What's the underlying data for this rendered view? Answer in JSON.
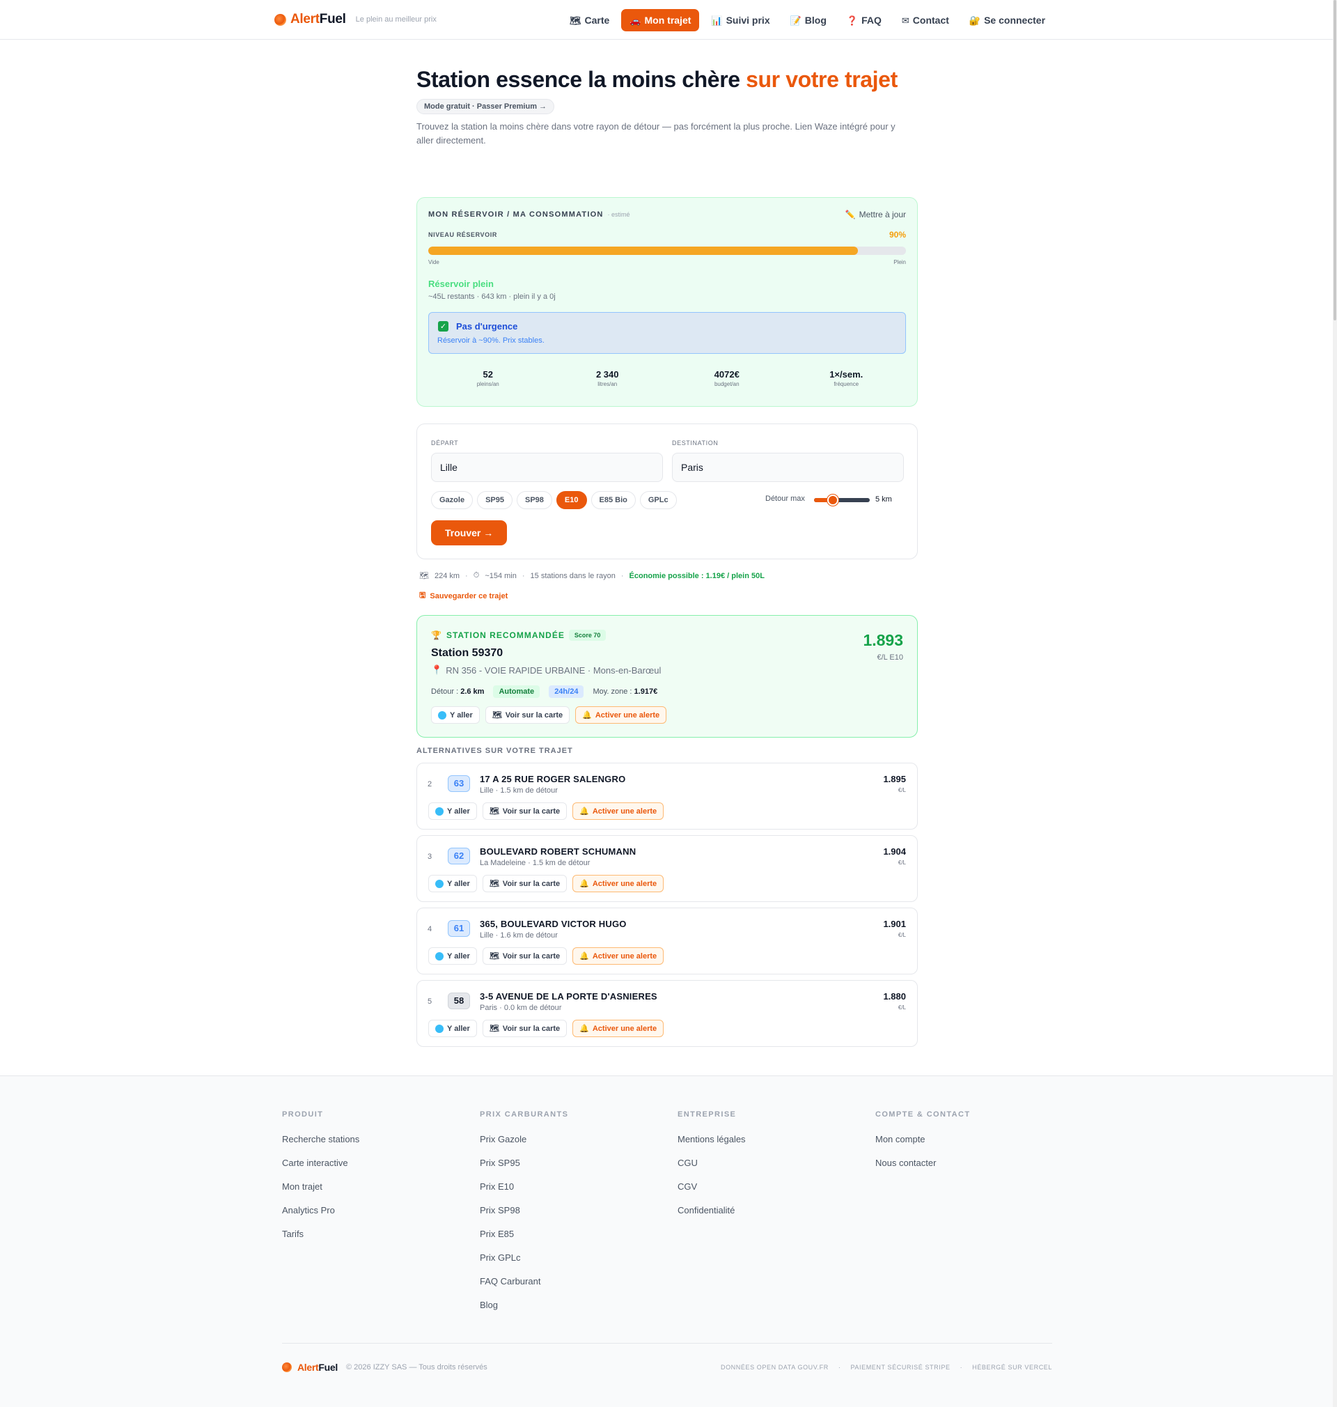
{
  "header": {
    "brand_a": "Alert",
    "brand_b": "Fuel",
    "tagline": "Le plein au meilleur prix",
    "nav": [
      {
        "label": "Carte",
        "icon": "🗺"
      },
      {
        "label": "Mon trajet",
        "icon": "🚗"
      },
      {
        "label": "Suivi prix",
        "icon": "📊"
      },
      {
        "label": "Blog",
        "icon": "📝"
      },
      {
        "label": "FAQ",
        "icon": "❓"
      },
      {
        "label": "Contact",
        "icon": "✉"
      },
      {
        "label": "Se connecter",
        "icon": "🔐"
      }
    ]
  },
  "hero": {
    "title_main": "Station essence la moins chère ",
    "title_highlight": "sur votre trajet",
    "premium_pill": "Mode gratuit · Passer Premium →",
    "intro": "Trouvez la station la moins chère dans votre rayon de détour — pas forcément la plus proche. Lien Waze intégré pour y aller directement."
  },
  "reservoir": {
    "title": "MON RÉSERVOIR / MA CONSOMMATION",
    "estimated": "· estimé",
    "update_label": "Mettre à jour",
    "level_label": "NIVEAU RÉSERVOIR",
    "level_pct_text": "90%",
    "level_fraction": 0.9,
    "empty_label": "Vide",
    "full_label": "Plein",
    "state": "Réservoir plein",
    "state_detail": "~45L restants · 643 km · plein il y a 0j",
    "urgency_title": "Pas d'urgence",
    "urgency_detail": "Réservoir à ~90%. Prix stables.",
    "stats": [
      {
        "value": "52",
        "label": "pleins/an"
      },
      {
        "value": "2 340",
        "label": "litres/an"
      },
      {
        "value": "4072€",
        "label": "budget/an"
      },
      {
        "value": "1×/sem.",
        "label": "fréquence"
      }
    ]
  },
  "route_form": {
    "departure_label": "DÉPART",
    "departure_value": "Lille",
    "destination_label": "DESTINATION",
    "destination_value": "Paris",
    "fuels": [
      "Gazole",
      "SP95",
      "SP98",
      "E10",
      "E85 Bio",
      "GPLc"
    ],
    "selected_fuel": "E10",
    "detour_label": "Détour max",
    "detour_value": "5 km",
    "find_label": "Trouver →"
  },
  "route_info": {
    "distance": "224 km",
    "duration": "~154 min",
    "stations": "15 stations dans le rayon",
    "economy": "Économie possible : 1.19€ / plein 50L",
    "save_label": "Sauvegarder ce trajet"
  },
  "recommended": {
    "tag": "STATION RECOMMANDÉE",
    "score": "Score 70",
    "name": "Station 59370",
    "address": "RN 356 - VOIE RAPIDE URBAINE · Mons-en-Barœul",
    "price": "1.893",
    "unit": "€/L E10",
    "detour_label": "Détour :",
    "detour_value": "2.6 km",
    "badge_automate": "Automate",
    "badge_24": "24h/24",
    "avg_label": "Moy. zone :",
    "avg_value": "1.917€"
  },
  "actions": {
    "go": "Y aller",
    "map": "Voir sur la carte",
    "alert": "Activer une alerte"
  },
  "alternatives": {
    "heading": "ALTERNATIVES SUR VOTRE TRAJET",
    "items": [
      {
        "rank": "2",
        "score": "63",
        "name": "17 A 25 RUE ROGER SALENGRO",
        "sub": "Lille · 1.5 km de détour",
        "price": "1.895",
        "unit": "€/L"
      },
      {
        "rank": "3",
        "score": "62",
        "name": "BOULEVARD ROBERT SCHUMANN",
        "sub": "La Madeleine · 1.5 km de détour",
        "price": "1.904",
        "unit": "€/L"
      },
      {
        "rank": "4",
        "score": "61",
        "name": "365, BOULEVARD VICTOR HUGO",
        "sub": "Lille · 1.6 km de détour",
        "price": "1.901",
        "unit": "€/L"
      },
      {
        "rank": "5",
        "score": "58",
        "name": "3-5 AVENUE DE LA PORTE D'ASNIERES",
        "sub": "Paris · 0.0 km de détour",
        "price": "1.880",
        "unit": "€/L"
      }
    ]
  },
  "footer": {
    "columns": [
      {
        "title": "PRODUIT",
        "links": [
          "Recherche stations",
          "Carte interactive",
          "Mon trajet",
          "Analytics Pro",
          "Tarifs"
        ]
      },
      {
        "title": "PRIX CARBURANTS",
        "links": [
          "Prix Gazole",
          "Prix SP95",
          "Prix E10",
          "Prix SP98",
          "Prix E85",
          "Prix GPLc",
          "FAQ Carburant",
          "Blog"
        ]
      },
      {
        "title": "ENTREPRISE",
        "links": [
          "Mentions légales",
          "CGU",
          "CGV",
          "Confidentialité"
        ]
      },
      {
        "title": "COMPTE & CONTACT",
        "links": [
          "Mon compte",
          "Nous contacter"
        ]
      }
    ],
    "copyright": "© 2026 IZZY SAS — Tous droits réservés",
    "badges": [
      "DONNÉES OPEN DATA GOUV.FR",
      "·",
      "PAIEMENT SÉCURISÉ STRIPE",
      "·",
      "HÉBERGÉ SUR VERCEL"
    ]
  },
  "colors": {
    "accent": "#ea580c",
    "green": "#16a34a",
    "blue": "#3b82f6",
    "tank": "#f5a623"
  }
}
